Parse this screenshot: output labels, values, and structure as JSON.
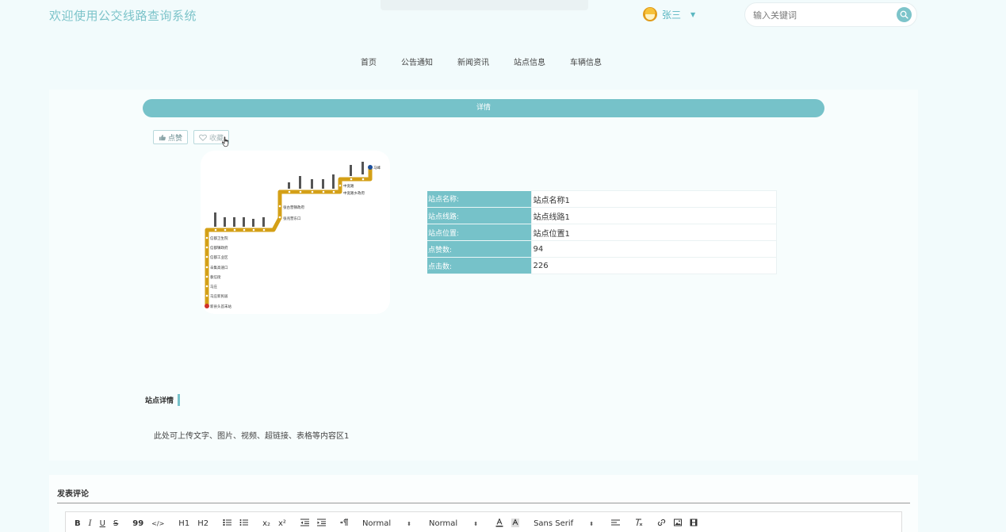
{
  "header": {
    "site_title": "欢迎使用公交线路查询系统",
    "user_name": "张三",
    "search_placeholder": "输入关键词"
  },
  "nav": {
    "items": [
      "首页",
      "公告通知",
      "新闻资讯",
      "站点信息",
      "车辆信息"
    ]
  },
  "detail": {
    "bar_label": "详情",
    "like_label": "点赞",
    "favorite_label": "收藏",
    "map_station_labels": [
      "马峰",
      "中宽路",
      "中宽路乡政府",
      "张古营镇政府",
      "张兆营东口",
      "信都卫生院",
      "信都镇政府",
      "信都工业区",
      "辛集高速口",
      "裴信街",
      "马庄",
      "马庄新民居",
      "新县头首末站"
    ],
    "info": [
      {
        "label": "站点名称:",
        "value": "站点名称1"
      },
      {
        "label": "站点线路:",
        "value": "站点线路1"
      },
      {
        "label": "站点位置:",
        "value": "站点位置1"
      },
      {
        "label": "点赞数:",
        "value": "94"
      },
      {
        "label": "点击数:",
        "value": "226"
      }
    ],
    "section_title": "站点详情",
    "section_content": "此处可上传文字、图片、视频、超链接、表格等内容区1"
  },
  "comment": {
    "title": "发表评论",
    "toolbar": {
      "bold": "B",
      "italic": "I",
      "underline": "U",
      "strike": "S",
      "quote": "99",
      "code": "</>",
      "h1": "H1",
      "h2": "H2",
      "sub": "x₂",
      "sup": "x²",
      "header_select": "Normal",
      "size_select": "Normal",
      "font_select": "Sans Serif"
    }
  },
  "colors": {
    "accent": "#76c2c9",
    "title": "#7dc4ca",
    "background": "#f2fbfc",
    "map_line": "#d4a017"
  }
}
